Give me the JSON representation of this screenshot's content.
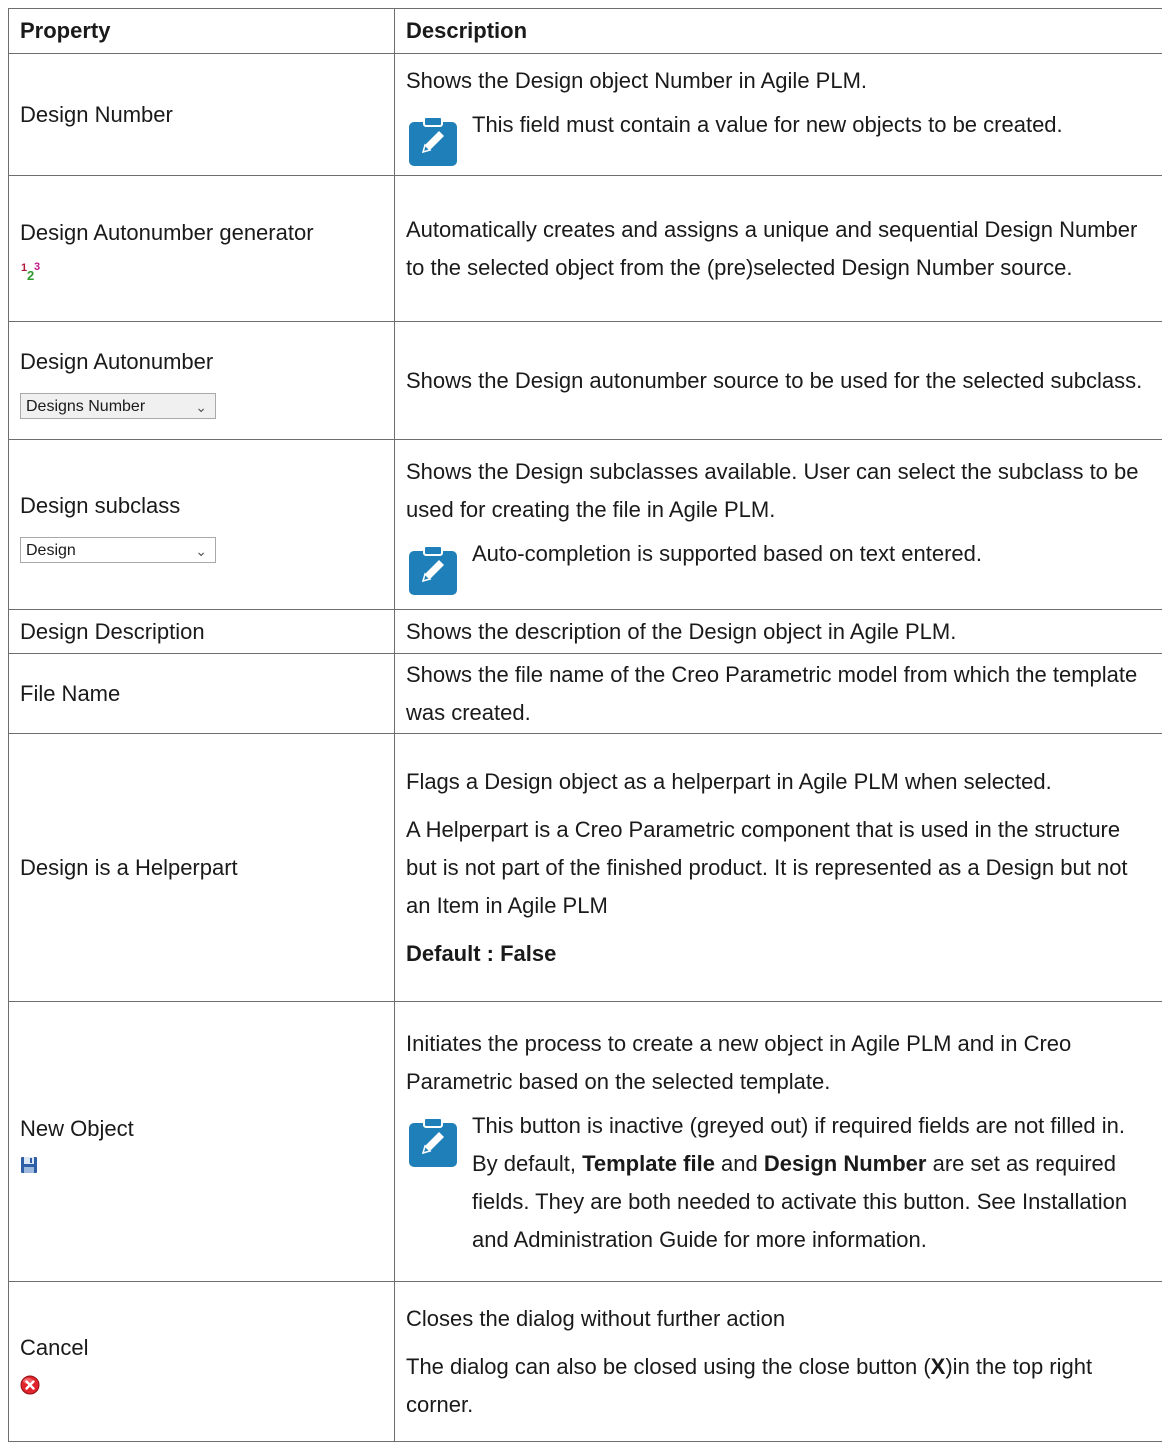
{
  "headers": {
    "property": "Property",
    "description": "Description"
  },
  "rows": {
    "design_number": {
      "property": "Design Number",
      "desc": "Shows the Design object Number in Agile PLM.",
      "note": "This field must contain a value for new objects to be created."
    },
    "autonumber_generator": {
      "property": "Design Autonumber generator",
      "desc": "Automatically creates and assigns a unique and sequential Design Number to the selected object from the (pre)selected Design Number source.",
      "icon": "autonumber-123-icon"
    },
    "design_autonumber": {
      "property": "Design Autonumber",
      "combo_value": "Designs Number",
      "desc": "Shows the Design autonumber source to be used for the selected subclass."
    },
    "design_subclass": {
      "property": "Design subclass",
      "combo_value": "Design",
      "desc": "Shows the Design subclasses available. User can select the subclass to be used for creating the file in Agile PLM.",
      "note": "Auto-completion is supported based on text entered."
    },
    "design_description": {
      "property": "Design Description",
      "desc": "Shows the description of the Design object in Agile PLM."
    },
    "file_name": {
      "property": "File Name",
      "desc": "Shows the file name of the Creo Parametric model from which the template was created."
    },
    "helperpart": {
      "property": "Design is a Helperpart",
      "desc1": "Flags a Design object as a helperpart in Agile PLM when selected.",
      "desc2": "A Helperpart is a Creo Parametric component that is used in the structure but is not part of the finished product. It is represented as a Design but not an Item in Agile PLM",
      "default": "Default : False"
    },
    "new_object": {
      "property": "New Object",
      "desc": "Initiates the process to create a new object in Agile PLM and in Creo Parametric based on the selected template.",
      "note_part1": "This button is inactive (greyed out) if required fields are not filled in. By default, ",
      "note_bold1": "Template file",
      "note_part2": " and ",
      "note_bold2": "Design Number",
      "note_part3": " are set as required fields. They are both needed to activate this button. See Installation and Administration Guide for more information.",
      "icon": "save-disk-icon"
    },
    "cancel": {
      "property": "Cancel",
      "desc1": "Closes the dialog without further action",
      "desc2_part1": "The dialog can also be closed using the close button (",
      "desc2_bold": "X",
      "desc2_part2": ")in the top right corner.",
      "icon": "cancel-circle-icon"
    }
  },
  "colors": {
    "note_icon": "#1f7fb8",
    "border": "#6e6e6e",
    "cancel_red": "#e0242b"
  }
}
